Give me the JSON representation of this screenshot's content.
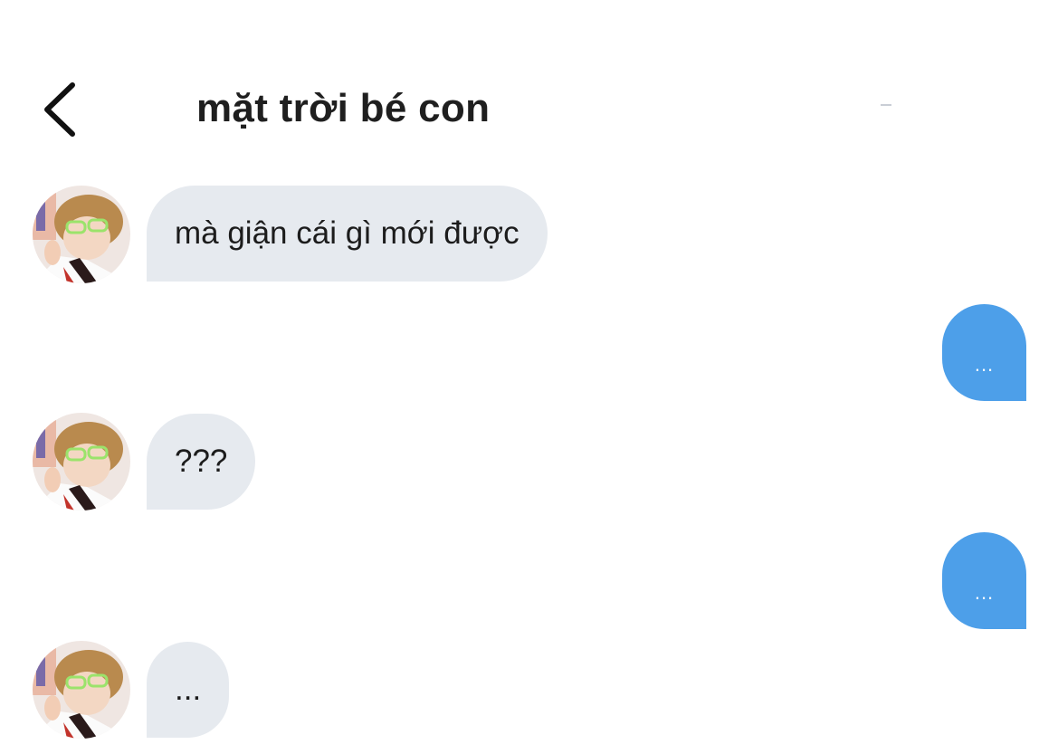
{
  "header": {
    "title": "mặt trời bé con",
    "back_icon": "chevron-left-icon"
  },
  "colors": {
    "incoming_bubble": "#e6eaef",
    "outgoing_bubble": "#4d9fe9",
    "text": "#1c1c1c",
    "background": "#ffffff"
  },
  "messages": [
    {
      "direction": "incoming",
      "text": "mà giận cái gì mới được"
    },
    {
      "direction": "outgoing",
      "text": "..."
    },
    {
      "direction": "incoming",
      "text": "???"
    },
    {
      "direction": "outgoing",
      "text": "..."
    },
    {
      "direction": "incoming",
      "text": "..."
    }
  ]
}
